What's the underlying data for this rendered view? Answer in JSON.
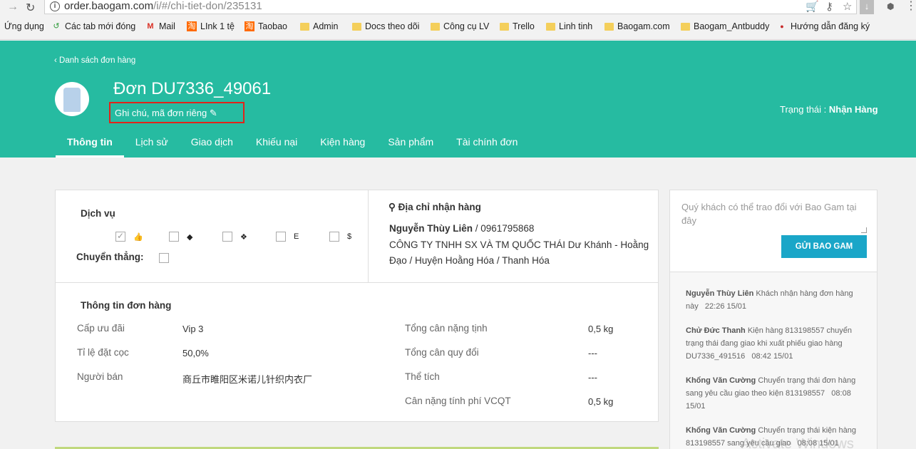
{
  "browser": {
    "url_host": "order.baogam.com",
    "url_path": "/i/#/chi-tiet-don/235131",
    "bookmarks": [
      {
        "label": "Ứng dụng",
        "icon": "apps-icon"
      },
      {
        "label": "Các tab mới đóng",
        "icon": "restore-icon"
      },
      {
        "label": "Mail",
        "icon": "gmail-icon"
      },
      {
        "label": "LInk 1 tệ",
        "icon": "taobao-icon"
      },
      {
        "label": "Taobao",
        "icon": "taobao-icon"
      },
      {
        "label": "Admin",
        "icon": "folder-icon"
      },
      {
        "label": "Docs theo dõi",
        "icon": "folder-icon"
      },
      {
        "label": "Công cụ LV",
        "icon": "folder-icon"
      },
      {
        "label": "Trello",
        "icon": "folder-icon"
      },
      {
        "label": "Linh tinh",
        "icon": "folder-icon"
      },
      {
        "label": "Baogam.com",
        "icon": "folder-icon"
      },
      {
        "label": "Baogam_Antbuddy",
        "icon": "folder-icon"
      },
      {
        "label": "Hướng dẫn đăng ký",
        "icon": "site-icon"
      }
    ]
  },
  "header": {
    "back_link": "Danh sách đơn hàng",
    "order_title": "Đơn DU7336_49061",
    "note_label": "Ghi chú, mã đơn riêng",
    "status_label": "Trạng thái :",
    "status_value": "Nhận Hàng",
    "tabs": [
      "Thông tin",
      "Lịch sử",
      "Giao dịch",
      "Khiếu nại",
      "Kiện hàng",
      "Sản phẩm",
      "Tài chính đơn"
    ],
    "active_tab": "Thông tin"
  },
  "services": {
    "title": "Dịch vụ",
    "items": [
      {
        "icon": "thumbs-up-icon",
        "glyph": "👍",
        "checked": true
      },
      {
        "icon": "box-icon",
        "glyph": "◆",
        "checked": false
      },
      {
        "icon": "cubes-icon",
        "glyph": "❖",
        "checked": false
      },
      {
        "icon": "letter-e-icon",
        "glyph": "E",
        "checked": false
      },
      {
        "icon": "dollar-icon",
        "glyph": "$",
        "checked": false
      }
    ],
    "direct_label": "Chuyển thẳng:",
    "direct_checked": false
  },
  "address": {
    "title": "Địa chỉ nhận hàng",
    "name": "Nguyễn Thùy Liên",
    "phone": " / 0961795868",
    "line": "CÔNG TY TNHH SX VÀ TM QUỐC THÁI Dư Khánh - Hoằng Đạo / Huyện Hoằng Hóa / Thanh Hóa"
  },
  "order_info": {
    "title": "Thông tin đơn hàng",
    "left": [
      {
        "label": "Cấp ưu đãi",
        "value": "Vip 3"
      },
      {
        "label": "Tỉ lệ đặt cọc",
        "value": "50,0%"
      },
      {
        "label": "Người bán",
        "value": "商丘市睢阳区米诺儿针织内衣厂"
      }
    ],
    "right": [
      {
        "label": "Tổng cân nặng tịnh",
        "value": "0,5 kg"
      },
      {
        "label": "Tổng cân quy đổi",
        "value": "---"
      },
      {
        "label": "Thể tích",
        "value": "---"
      },
      {
        "label": "Cân nặng tính phí VCQT",
        "value": "0,5 kg"
      }
    ]
  },
  "side": {
    "placeholder": "Quý khách có thể trao đổi với Bao Gam tại đây",
    "send_label": "GỬI BAO GAM",
    "timeline": [
      {
        "author": "Nguyễn Thùy Liên",
        "text": " Khách nhận hàng đơn hàng này",
        "time": "22:26 15/01"
      },
      {
        "author": "Chử Đức Thanh",
        "text": " Kiện hàng 813198557 chuyển trạng thái đang giao khi xuất phiếu giao hàng DU7336_491516",
        "time": "08:42 15/01"
      },
      {
        "author": "Khổng Văn Cường",
        "text": " Chuyển trạng thái đơn hàng sang yêu cầu giao theo kiện 813198557",
        "time": "08:08 15/01"
      },
      {
        "author": "Khổng Văn Cường",
        "text": " Chuyển trạng thái kiện hàng 813198557 sang yêu cầu giao",
        "time": "08:08 15/01"
      }
    ]
  },
  "watermark": "Activate Windows"
}
